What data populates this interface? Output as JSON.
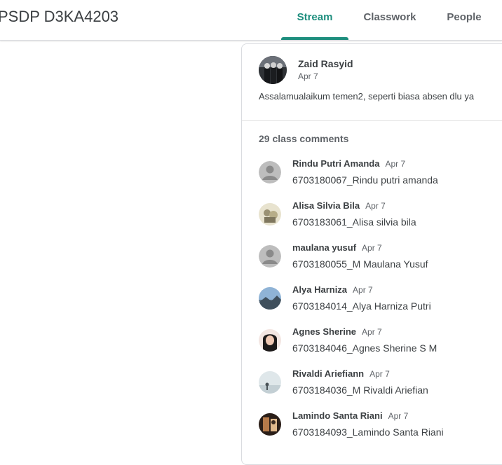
{
  "header": {
    "course_title": "PSDP D3KA4203",
    "tabs": [
      {
        "label": "Stream",
        "active": true
      },
      {
        "label": "Classwork",
        "active": false
      },
      {
        "label": "People",
        "active": false
      }
    ],
    "accent_color": "#1e8e7e"
  },
  "post": {
    "author": "Zaid Rasyid",
    "date": "Apr 7",
    "text": "Assalamualaikum temen2, seperti biasa absen dlu ya",
    "comments_count_label": "29 class comments"
  },
  "comments": [
    {
      "name": "Rindu Putri Amanda",
      "date": "Apr 7",
      "text": "6703180067_Rindu putri amanda",
      "avatar": "default-person-icon"
    },
    {
      "name": "Alisa Silvia Bila",
      "date": "Apr 7",
      "text": "6703183061_Alisa silvia bila",
      "avatar": "photo-avatar"
    },
    {
      "name": "maulana yusuf",
      "date": "Apr 7",
      "text": "6703180055_M Maulana Yusuf",
      "avatar": "default-person-icon"
    },
    {
      "name": "Alya Harniza",
      "date": "Apr 7",
      "text": "6703184014_Alya Harniza Putri",
      "avatar": "photo-avatar"
    },
    {
      "name": "Agnes Sherine",
      "date": "Apr 7",
      "text": "6703184046_Agnes Sherine S M",
      "avatar": "photo-avatar"
    },
    {
      "name": "Rivaldi Ariefiann",
      "date": "Apr 7",
      "text": "6703184036_M Rivaldi Ariefian",
      "avatar": "photo-avatar"
    },
    {
      "name": "Lamindo Santa Riani",
      "date": "Apr 7",
      "text": "6703184093_Lamindo Santa Riani",
      "avatar": "photo-avatar"
    }
  ]
}
